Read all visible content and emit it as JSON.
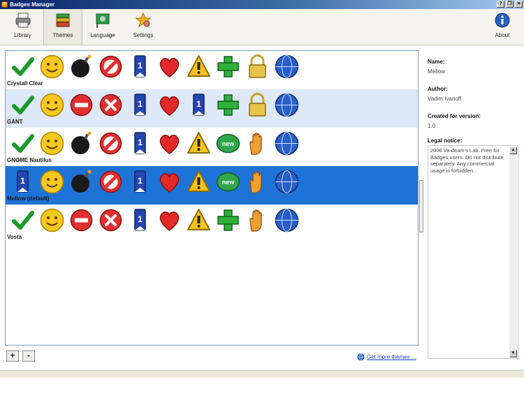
{
  "window": {
    "title": "Badges Manager"
  },
  "window_controls": {
    "help": "?",
    "restore": "❐",
    "close": "✕"
  },
  "toolbar": {
    "library_label": "Library",
    "themes_label": "Themes",
    "language_label": "Language",
    "settings_label": "Settings",
    "about_label": "About"
  },
  "themes": [
    {
      "name": "Crystall Clear",
      "badges": [
        "check",
        "smiley",
        "bomb",
        "forbidden",
        "ribbon",
        "heart",
        "warning",
        "plus",
        "lock",
        "globe"
      ]
    },
    {
      "name": "GANT",
      "badges": [
        "check",
        "smiley",
        "minus",
        "x",
        "ribbon",
        "heart",
        "ribbon",
        "plus",
        "lock",
        "globe"
      ]
    },
    {
      "name": "GNOME Nautilus",
      "badges": [
        "check",
        "smiley",
        "bomb",
        "forbidden",
        "ribbon",
        "heart",
        "warning",
        "new",
        "hand",
        "globe"
      ]
    },
    {
      "name": "Mellow (default)",
      "badges": [
        "ribbon",
        "smiley",
        "bomb",
        "forbidden",
        "ribbon",
        "heart",
        "warning",
        "new",
        "hand",
        "globe"
      ]
    },
    {
      "name": "Vosta",
      "badges": [
        "check",
        "smiley",
        "minus",
        "x",
        "ribbon",
        "heart",
        "warning",
        "plus",
        "hand",
        "globe"
      ]
    }
  ],
  "details": {
    "name_label": "Name:",
    "name_value": "Mellow",
    "author_label": "Author:",
    "author_value": "Vadim Ivanoff",
    "version_label": "Created for version:",
    "version_value": "1.0",
    "legal_label": "Legal notice:",
    "legal_text": "2006 Va-deam's Lab. Free for Badges users. Do not distribute separately. Any commercial usage is forbidden."
  },
  "bottom": {
    "add_label": "+",
    "remove_label": "-",
    "get_more": "Get more themes ..."
  },
  "scroll": {
    "up": "▲",
    "down": "▼"
  }
}
